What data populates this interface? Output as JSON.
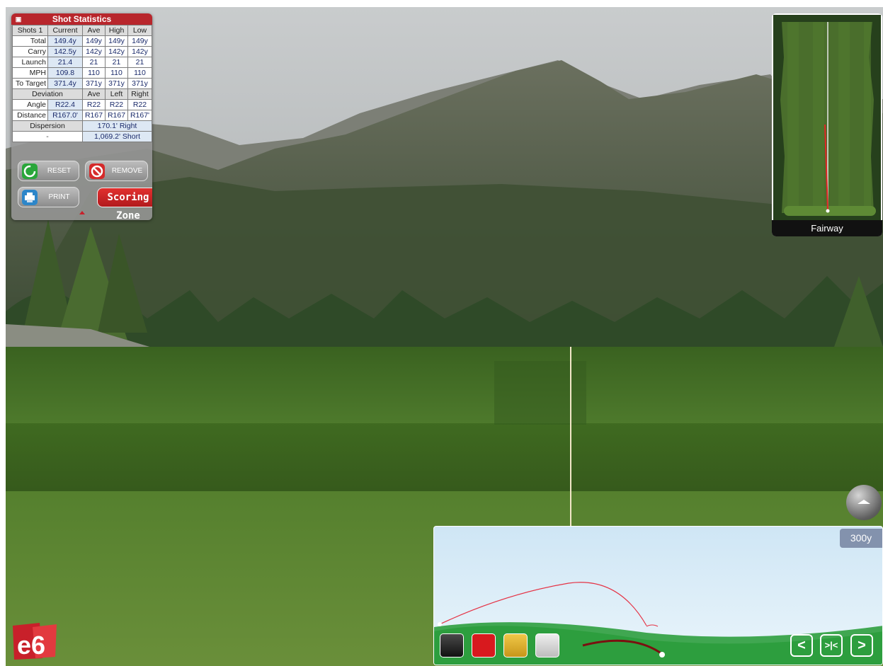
{
  "stats": {
    "title": "Shot Statistics",
    "header": [
      "Shots 1",
      "Current",
      "Ave",
      "High",
      "Low"
    ],
    "rows": [
      {
        "label": "Total",
        "current": "149.4y",
        "ave": "149y",
        "high": "149y",
        "low": "149y"
      },
      {
        "label": "Carry",
        "current": "142.5y",
        "ave": "142y",
        "high": "142y",
        "low": "142y"
      },
      {
        "label": "Launch",
        "current": "21.4",
        "ave": "21",
        "high": "21",
        "low": "21"
      },
      {
        "label": "MPH",
        "current": "109.8",
        "ave": "110",
        "high": "110",
        "low": "110"
      },
      {
        "label": "To Target",
        "current": "371.4y",
        "ave": "371y",
        "high": "371y",
        "low": "371y"
      }
    ],
    "deviation_header": [
      "Deviation",
      "Ave",
      "Left",
      "Right"
    ],
    "deviation_rows": [
      {
        "label": "Angle",
        "current": "R22.4",
        "ave": "R22",
        "left": "R22",
        "right": "R22"
      },
      {
        "label": "Distance",
        "current": "R167.0'",
        "ave": "R167",
        "left": "R167",
        "right": "R167'"
      }
    ],
    "dispersion": {
      "label": "Dispersion",
      "value": "170.1'  Right",
      "blank_label": "-",
      "short_value": "1,069.2'  Short"
    }
  },
  "buttons": {
    "reset": "RESET",
    "remove": "REMOVE",
    "print": "PRINT",
    "scoring": "Scoring Zone"
  },
  "minimap": {
    "label": "Fairway"
  },
  "tracer": {
    "distance": "300y",
    "swatches": [
      "#2a2a2a",
      "#d8191e",
      "#e0b02a",
      "#d6d6d6"
    ]
  },
  "nav": {
    "prev": "<",
    "center": ">|<",
    "next": ">"
  },
  "logo": {
    "text": "e6"
  },
  "colors": {
    "accent": "#b8262c",
    "grass": "#4d7a28",
    "sky": "#aeb3b6"
  }
}
